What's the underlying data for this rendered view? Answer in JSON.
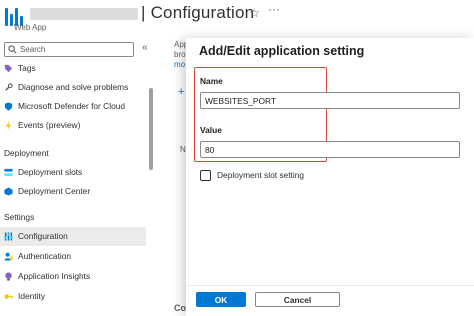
{
  "header": {
    "title": "Configuration",
    "subtitle": "Web App",
    "separator": "|"
  },
  "sidebar": {
    "search_placeholder": "Search",
    "collapse_label": "«",
    "items_top": [
      {
        "label": "Tags",
        "icon": "tag-icon"
      },
      {
        "label": "Diagnose and solve problems",
        "icon": "wrench-icon"
      },
      {
        "label": "Microsoft Defender for Cloud",
        "icon": "shield-icon"
      },
      {
        "label": "Events (preview)",
        "icon": "lightning-icon"
      }
    ],
    "section_deployment": "Deployment",
    "items_deployment": [
      {
        "label": "Deployment slots",
        "icon": "slots-icon"
      },
      {
        "label": "Deployment Center",
        "icon": "cube-icon"
      }
    ],
    "section_settings": "Settings",
    "items_settings": [
      {
        "label": "Configuration",
        "icon": "sliders-icon",
        "active": true
      },
      {
        "label": "Authentication",
        "icon": "person-key-icon"
      },
      {
        "label": "Application Insights",
        "icon": "lightbulb-icon"
      },
      {
        "label": "Identity",
        "icon": "key-icon"
      }
    ]
  },
  "background": {
    "peek1": "App",
    "peek2": "bro",
    "peek3": "mo",
    "peek4": "+",
    "peek5": "N",
    "peek6": "Co"
  },
  "dialog": {
    "title": "Add/Edit application setting",
    "name_label": "Name",
    "name_value": "WEBSITES_PORT",
    "value_label": "Value",
    "value_value": "80",
    "slot_setting_label": "Deployment slot setting",
    "ok_label": "OK",
    "cancel_label": "Cancel"
  },
  "colors": {
    "accent": "#0078d4",
    "highlight_border": "#e0443e"
  }
}
